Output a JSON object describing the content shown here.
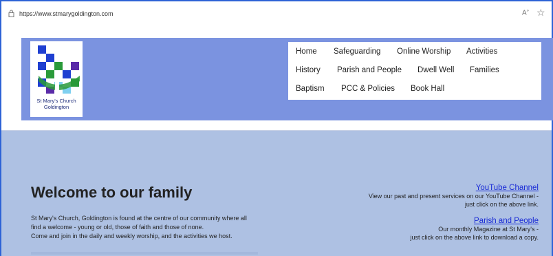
{
  "browser": {
    "url": "https://www.stmarygoldington.com"
  },
  "logo": {
    "line1": "St Mary's Church",
    "line2": "Goldington"
  },
  "nav": {
    "items": [
      {
        "label": "Home"
      },
      {
        "label": "Safeguarding"
      },
      {
        "label": "Online Worship"
      },
      {
        "label": "Activities"
      },
      {
        "label": "History"
      },
      {
        "label": "Parish and People"
      },
      {
        "label": "Dwell Well"
      },
      {
        "label": "Families"
      },
      {
        "label": "Baptism"
      },
      {
        "label": "PCC & Policies"
      },
      {
        "label": "Book Hall"
      }
    ]
  },
  "welcome": {
    "title": "Welcome to our family",
    "line1": "St Mary's Church, Goldington is found at the centre of our community where all",
    "line2": "find a welcome - young or old, those of faith and those of none.",
    "line3": "Come and join in the daily and weekly worship, and the activities we host."
  },
  "sidebar": {
    "youtube_link": "YouTube Channel",
    "youtube_desc1": "View our past and present services on our YouTube Channel -",
    "youtube_desc2": "just click on the above link.",
    "parish_link": "Parish and People",
    "parish_desc1": "Our monthly Magazine at St Mary's -",
    "parish_desc2": "just click on the above link to download a copy."
  },
  "colors": {
    "header_band": "#7b93e0",
    "hero_bg": "#aec1e3",
    "link": "#1a2bd6"
  }
}
